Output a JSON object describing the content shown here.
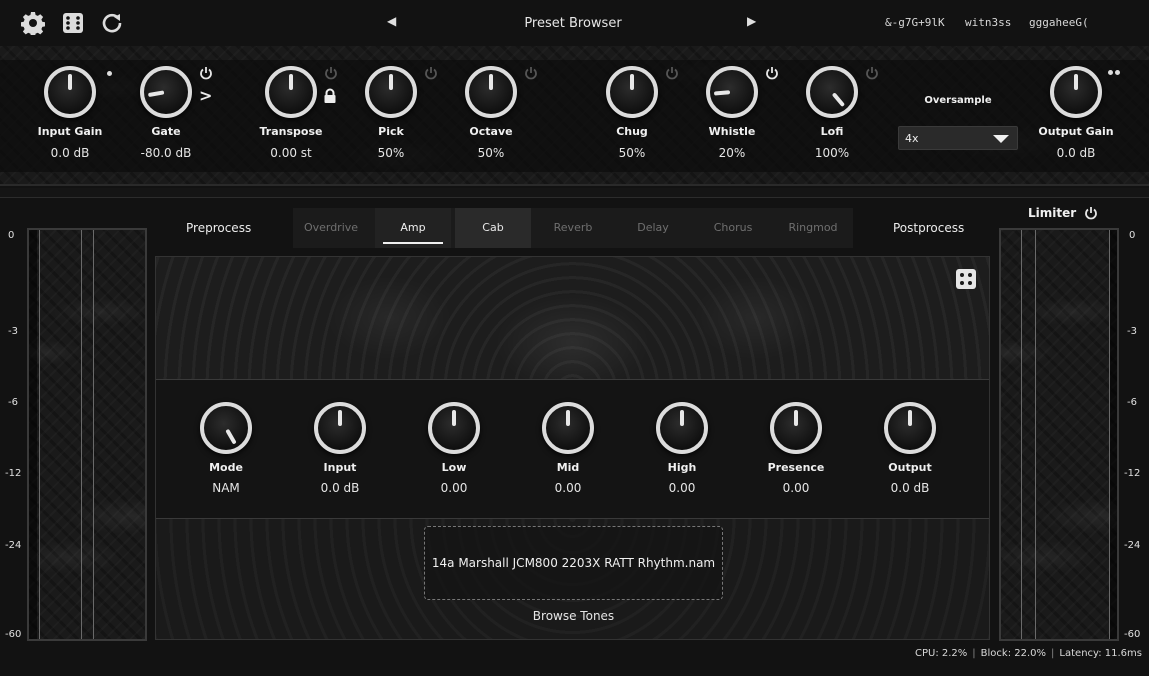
{
  "toolbar": {
    "preset_title": "Preset Browser",
    "prev_glyph": "◀",
    "next_glyph": "▶",
    "icons": [
      "gear-icon",
      "dice-icon",
      "reset-icon"
    ],
    "sidechain_slots": [
      "&-g7G+9lK",
      "witn3ss",
      "gggaheeG("
    ]
  },
  "top_knobs": [
    {
      "label": "Input Gain",
      "value": "0.0 dB"
    },
    {
      "label": "Gate",
      "value": "-80.0 dB"
    },
    {
      "label": "Transpose",
      "value": "0.00 st"
    },
    {
      "label": "Pick",
      "value": "50%"
    },
    {
      "label": "Octave",
      "value": "50%"
    },
    {
      "label": "Chug",
      "value": "50%"
    },
    {
      "label": "Whistle",
      "value": "20%"
    },
    {
      "label": "Lofi",
      "value": "100%"
    },
    {
      "label": "Output Gain",
      "value": "0.0 dB"
    }
  ],
  "gate_arrow": ">",
  "oversample": {
    "label": "Oversample",
    "value": "4x"
  },
  "tabs": {
    "preprocess": "Preprocess",
    "postprocess": "Postprocess",
    "items": [
      "Overdrive",
      "Amp",
      "Cab",
      "Reverb",
      "Delay",
      "Chorus",
      "Ringmod"
    ],
    "active": "Amp"
  },
  "limiter": {
    "label": "Limiter",
    "enabled": true
  },
  "meter_scale": [
    "0",
    "-3",
    "-6",
    "-12",
    "-24",
    "-60"
  ],
  "amp": {
    "knobs": [
      {
        "label": "Mode",
        "value": "NAM"
      },
      {
        "label": "Input",
        "value": "0.0 dB"
      },
      {
        "label": "Low",
        "value": "0.00"
      },
      {
        "label": "Mid",
        "value": "0.00"
      },
      {
        "label": "High",
        "value": "0.00"
      },
      {
        "label": "Presence",
        "value": "0.00"
      },
      {
        "label": "Output",
        "value": "0.0 dB"
      }
    ],
    "tone_file": "14a Marshall JCM800 2203X RATT Rhythm.nam",
    "browse_label": "Browse Tones"
  },
  "status": {
    "cpu": "CPU: 2.2%",
    "block": "Block: 22.0%",
    "latency": "Latency: 11.6ms"
  }
}
